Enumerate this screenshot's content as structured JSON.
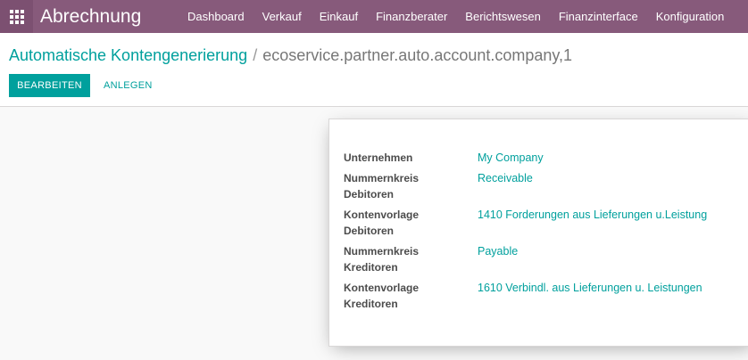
{
  "topbar": {
    "apps_icon": "apps-grid-icon",
    "app_name": "Abrechnung",
    "menu": [
      "Dashboard",
      "Verkauf",
      "Einkauf",
      "Finanzberater",
      "Berichtswesen",
      "Finanzinterface",
      "Konfiguration"
    ],
    "color": "#875a7b"
  },
  "breadcrumb": {
    "parent": "Automatische Kontengenerierung",
    "separator": "/",
    "current": "ecoservice.partner.auto.account.company,1"
  },
  "buttons": {
    "edit": "BEARBEITEN",
    "create": "ANLEGEN"
  },
  "form": {
    "fields": [
      {
        "label": "Unternehmen",
        "value": "My Company"
      },
      {
        "label": "Nummernkreis Debitoren",
        "value": "Receivable"
      },
      {
        "label": "Kontenvorlage Debitoren",
        "value": "1410 Forderungen aus Lieferungen u.Leistung"
      },
      {
        "label": "Nummernkreis Kreditoren",
        "value": "Payable"
      },
      {
        "label": "Kontenvorlage Kreditoren",
        "value": "1610 Verbindl. aus Lieferungen u. Leistungen"
      }
    ]
  },
  "accent_color": "#00a09d"
}
